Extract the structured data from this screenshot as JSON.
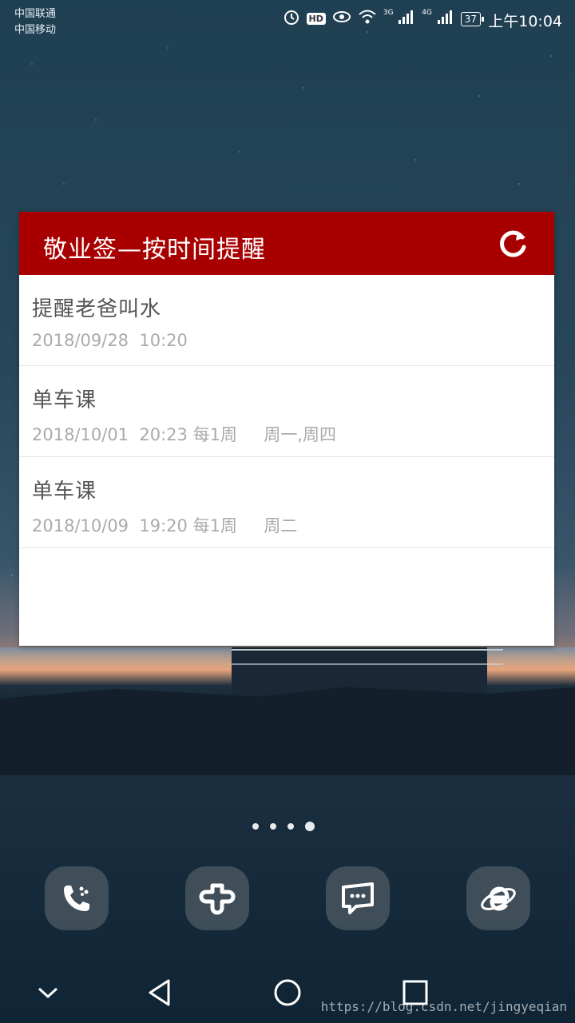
{
  "status_bar": {
    "carrier_1": "中国联通",
    "carrier_2": "中国移动",
    "network_3g": "3G",
    "network_4g": "4G",
    "hd_label": "HD",
    "battery": "37",
    "time": "上午10:04"
  },
  "widget": {
    "title": "敬业签—按时间提醒",
    "header_color": "#a80000",
    "refresh_icon": "refresh-icon",
    "reminders": [
      {
        "title": "提醒老爸叫水",
        "subtitle": "2018/09/28  10:20"
      },
      {
        "title": "单车课",
        "subtitle": "2018/10/01  20:23 每1周     周一,周四"
      },
      {
        "title": "单车课",
        "subtitle": "2018/10/09  19:20 每1周     周二"
      }
    ]
  },
  "home": {
    "page_count": 4,
    "active_page": 4
  },
  "dock": [
    {
      "name": "phone-icon"
    },
    {
      "name": "app-icon"
    },
    {
      "name": "messages-icon"
    },
    {
      "name": "browser-icon"
    }
  ],
  "nav": {
    "watermark": "https://blog.csdn.net/jingyeqian"
  }
}
